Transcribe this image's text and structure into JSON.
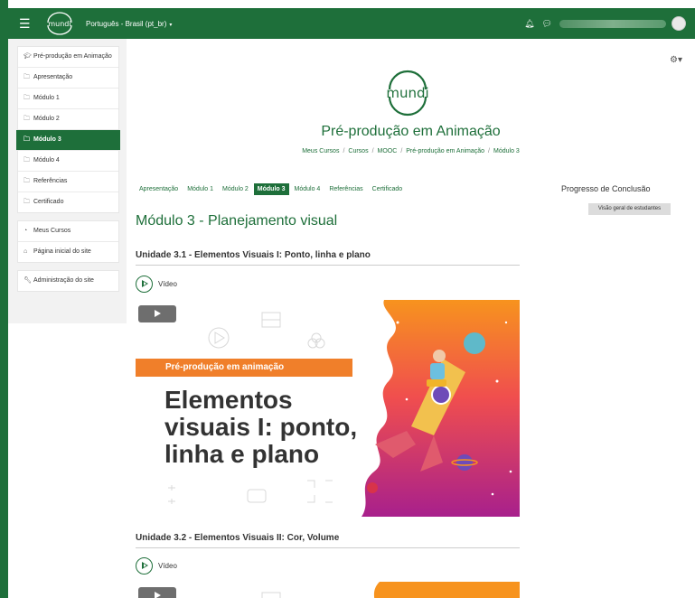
{
  "topbar": {
    "logo_text": "mundi",
    "language": "Português - Brasil (pt_br)"
  },
  "drawer": {
    "course_items": [
      {
        "label": "Pré-produção em Animação",
        "icon": "graduation-cap-icon"
      },
      {
        "label": "Apresentação",
        "icon": "folder-icon"
      },
      {
        "label": "Módulo 1",
        "icon": "folder-icon"
      },
      {
        "label": "Módulo 2",
        "icon": "folder-icon"
      },
      {
        "label": "Módulo 3",
        "icon": "folder-icon"
      },
      {
        "label": "Módulo 4",
        "icon": "folder-icon"
      },
      {
        "label": "Referências",
        "icon": "folder-icon"
      },
      {
        "label": "Certificado",
        "icon": "folder-icon"
      }
    ],
    "site_items": [
      {
        "label": "Meus Cursos",
        "icon": "dashboard-icon"
      },
      {
        "label": "Página inicial do site",
        "icon": "home-icon"
      }
    ],
    "admin_items": [
      {
        "label": "Administração do site",
        "icon": "wrench-icon"
      }
    ]
  },
  "course": {
    "logo_text": "mundi",
    "title": "Pré-produção em Animação",
    "breadcrumb": [
      "Meus Cursos",
      "Cursos",
      "MOOC",
      "Pré-produção em Animação",
      "Módulo 3"
    ]
  },
  "tabs": [
    "Apresentação",
    "Módulo 1",
    "Módulo 2",
    "Módulo 3",
    "Módulo 4",
    "Referências",
    "Certificado"
  ],
  "page": {
    "title": "Módulo 3 - Planejamento visual",
    "unit1": "Unidade 3.1 - Elementos Visuais I: Ponto, linha e plano",
    "unit2": "Unidade 3.2 - Elementos Visuais II: Cor, Volume",
    "video_label": "Vídeo"
  },
  "banner": {
    "ribbon": "Pré-produção em animação",
    "line1": "Elementos",
    "line2": "visuais I: ponto,",
    "line3": "linha e plano"
  },
  "progress": {
    "title": "Progresso de Conclusão",
    "button": "Visão geral de estudantes"
  },
  "colors": {
    "brand": "#1e6f3a",
    "ribbon": "#f07f2a"
  }
}
